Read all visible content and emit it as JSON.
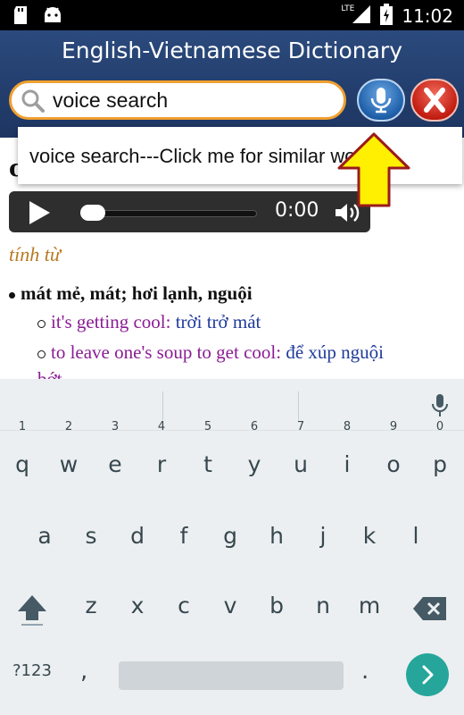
{
  "status_bar": {
    "time": "11:02",
    "network": "LTE",
    "icons": [
      "sd-card-icon",
      "android-icon",
      "signal-icon",
      "battery-charging-icon"
    ]
  },
  "header": {
    "title": "English-Vietnamese Dictionary",
    "search_value": "voice search",
    "mic_icon": "microphone-icon",
    "clear_icon": "close-icon"
  },
  "suggestion": {
    "text": "voice search---Click me for similar words"
  },
  "entry": {
    "headword": "cool",
    "player": {
      "time": "0:00"
    },
    "part_of_speech": "tính từ",
    "sense": "mát mẻ, mát; hơi lạnh, nguội",
    "examples": [
      {
        "en": "it's getting cool:",
        "vi": "trời trở mát"
      },
      {
        "en": "to leave one's soup to get cool:",
        "vi": "để xúp nguội"
      }
    ],
    "cutoff_line": "bớt"
  },
  "keyboard": {
    "row1": [
      {
        "key": "q",
        "hint": "1"
      },
      {
        "key": "w",
        "hint": "2"
      },
      {
        "key": "e",
        "hint": "3"
      },
      {
        "key": "r",
        "hint": "4"
      },
      {
        "key": "t",
        "hint": "5"
      },
      {
        "key": "y",
        "hint": "6"
      },
      {
        "key": "u",
        "hint": "7"
      },
      {
        "key": "i",
        "hint": "8"
      },
      {
        "key": "o",
        "hint": "9"
      },
      {
        "key": "p",
        "hint": "0"
      }
    ],
    "row2": [
      "a",
      "s",
      "d",
      "f",
      "g",
      "h",
      "j",
      "k",
      "l"
    ],
    "row3": [
      "z",
      "x",
      "c",
      "v",
      "b",
      "n",
      "m"
    ],
    "symbols_label": "?123",
    "comma": ",",
    "period": ".",
    "accent_color": "#26a69a"
  }
}
